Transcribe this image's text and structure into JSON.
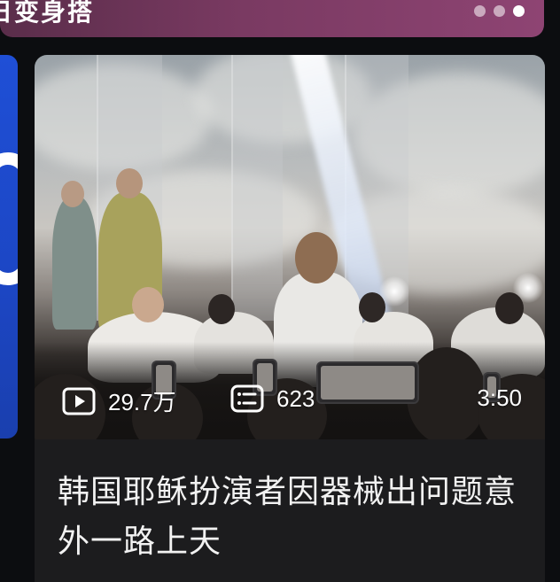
{
  "banner": {
    "title": "日变身搭",
    "dots": 3,
    "active_dot": 2
  },
  "video_card": {
    "thumbnail_description": "",
    "stats": {
      "plays": "29.7万",
      "comments": "623",
      "duration": "3:50"
    },
    "icons": {
      "plays": "play-icon",
      "comments": "comment-list-icon"
    },
    "title": "韩国耶稣扮演者因器械出问题意外一路上天"
  },
  "colors": {
    "banner_gradient_start": "#5a2d4a",
    "banner_gradient_end": "#8e4473",
    "left_card_blue": "#1f4fd6",
    "card_background": "#1c1c1e",
    "page_background": "#0c0d10",
    "text_primary": "#f2f2f2"
  }
}
